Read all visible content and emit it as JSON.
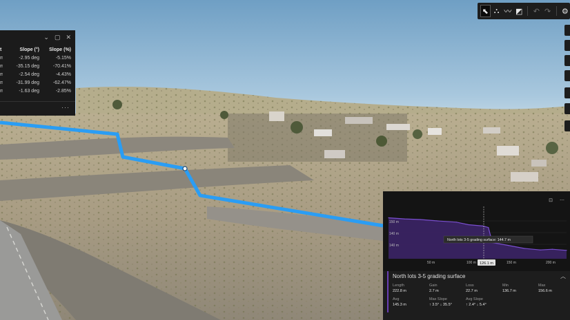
{
  "toolbar": {
    "tools": [
      {
        "name": "select-tool-button",
        "glyph": "⬉",
        "active": true
      },
      {
        "name": "elevation-tool-button",
        "glyph": "⛬",
        "active": false
      },
      {
        "name": "profile-line-tool-button",
        "glyph": "〰",
        "active": false
      },
      {
        "name": "profile-area-tool-button",
        "glyph": "◩",
        "active": false
      }
    ],
    "undo_glyph": "↶",
    "redo_glyph": "↷",
    "settings_glyph": "⚙"
  },
  "slope_table": {
    "col_headers": [
      "Slope (°)",
      "Slope (%)"
    ],
    "first_col_header_fragment": "t",
    "rows": [
      {
        "unit": "m",
        "slope_deg": "-2.95 deg",
        "slope_pct": "-5.15%"
      },
      {
        "unit": "m",
        "slope_deg": "-35.15 deg",
        "slope_pct": "-70.41%"
      },
      {
        "unit": "m",
        "slope_deg": "-2.54 deg",
        "slope_pct": "-4.43%"
      },
      {
        "unit": "m",
        "slope_deg": "-31.99 deg",
        "slope_pct": "-62.47%"
      },
      {
        "unit": "m",
        "slope_deg": "-1.63 deg",
        "slope_pct": "-2.85%"
      }
    ],
    "more_glyph": "···",
    "icons": {
      "collapse": "⌄",
      "dock": "▢",
      "close": "✕"
    }
  },
  "profile": {
    "y_ticks": [
      "150 m",
      "140 m",
      "140 m"
    ],
    "x_ticks": [
      "50 m",
      "100 m",
      "150 m",
      "200 m"
    ],
    "cursor_x_label": "126.1 m",
    "tooltip": "North lots 3-5 grading surface: 144.7 m",
    "top_icons": [
      "⊡",
      "⋯"
    ],
    "colors": {
      "fill": "#3b2466",
      "line": "#7a4fd0",
      "accent": "#6a3eb5",
      "path": "#2a9df4"
    }
  },
  "chart_data": {
    "type": "area",
    "title": "",
    "xlabel": "",
    "ylabel": "",
    "x": [
      0,
      20,
      40,
      60,
      85,
      100,
      118,
      125,
      130,
      150,
      170,
      190,
      205,
      222.8
    ],
    "series": [
      {
        "values": [
          152,
          151.5,
          151.2,
          150.6,
          150.0,
          148.8,
          148.2,
          147.5,
          140.5,
          139.2,
          137.8,
          137.1,
          137.4,
          136.9
        ]
      }
    ],
    "xlim": [
      0,
      222.8
    ],
    "ylim": [
      133,
      156
    ]
  },
  "stats": {
    "title": "North lots 3-5 grading surface",
    "collapse_glyph": "︿",
    "items": [
      {
        "label": "Length",
        "value": "222.8 m"
      },
      {
        "label": "Gain",
        "value": "2.7 m"
      },
      {
        "label": "Loss",
        "value": "22.7 m"
      },
      {
        "label": "Min",
        "value": "136.7 m"
      },
      {
        "label": "Max",
        "value": "156.6 m"
      },
      {
        "label": "Avg",
        "value": "145.3 m"
      },
      {
        "label": "Max Slope",
        "value": "↑ 3.5°  ↓ 35.5°"
      },
      {
        "label": "Avg Slope",
        "value": "↑ 2.4°  ↓ 5.4°"
      }
    ]
  }
}
